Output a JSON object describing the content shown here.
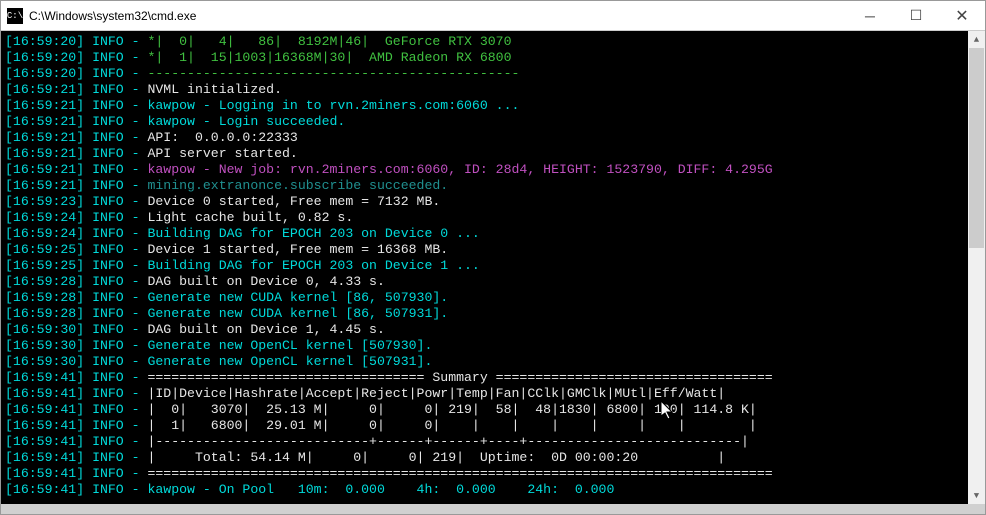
{
  "window": {
    "title": "C:\\Windows\\system32\\cmd.exe",
    "icon_label": "C:\\"
  },
  "lines": [
    {
      "ts": "16:59:20",
      "lvl": "INFO",
      "segs": [
        {
          "c": "green",
          "t": "*|  0|   4|   86|  8192M|46|  GeForce RTX 3070"
        }
      ]
    },
    {
      "ts": "16:59:20",
      "lvl": "INFO",
      "segs": [
        {
          "c": "green",
          "t": "*|  1|  15|1003|16368M|30|  AMD Radeon RX 6800"
        }
      ]
    },
    {
      "ts": "16:59:20",
      "lvl": "INFO",
      "segs": [
        {
          "c": "green",
          "t": "-----------------------------------------------"
        }
      ]
    },
    {
      "ts": "16:59:21",
      "lvl": "INFO",
      "segs": [
        {
          "c": "white",
          "t": "NVML initialized."
        }
      ]
    },
    {
      "ts": "16:59:21",
      "lvl": "INFO",
      "segs": [
        {
          "c": "cyan",
          "t": "kawpow - Logging in to rvn.2miners.com:6060 ..."
        }
      ]
    },
    {
      "ts": "16:59:21",
      "lvl": "INFO",
      "segs": [
        {
          "c": "cyan",
          "t": "kawpow - Login succeeded."
        }
      ]
    },
    {
      "ts": "16:59:21",
      "lvl": "INFO",
      "segs": [
        {
          "c": "white",
          "t": "API:  0.0.0.0:22333"
        }
      ]
    },
    {
      "ts": "16:59:21",
      "lvl": "INFO",
      "segs": [
        {
          "c": "white",
          "t": "API server started."
        }
      ]
    },
    {
      "ts": "16:59:21",
      "lvl": "INFO",
      "segs": [
        {
          "c": "magenta",
          "t": "kawpow - New job: rvn.2miners.com:6060, ID: 28d4, HEIGHT: 1523790, DIFF: 4.295G"
        }
      ]
    },
    {
      "ts": "16:59:21",
      "lvl": "INFO",
      "segs": [
        {
          "c": "teal",
          "t": "mining.extranonce.subscribe succeeded."
        }
      ]
    },
    {
      "ts": "16:59:23",
      "lvl": "INFO",
      "segs": [
        {
          "c": "white",
          "t": "Device 0 started, Free mem = 7132 MB."
        }
      ]
    },
    {
      "ts": "16:59:24",
      "lvl": "INFO",
      "segs": [
        {
          "c": "white",
          "t": "Light cache built, 0.82 s."
        }
      ]
    },
    {
      "ts": "16:59:24",
      "lvl": "INFO",
      "segs": [
        {
          "c": "cyan",
          "t": "Building DAG for EPOCH 203 on Device 0 ..."
        }
      ]
    },
    {
      "ts": "16:59:25",
      "lvl": "INFO",
      "segs": [
        {
          "c": "white",
          "t": "Device 1 started, Free mem = 16368 MB."
        }
      ]
    },
    {
      "ts": "16:59:25",
      "lvl": "INFO",
      "segs": [
        {
          "c": "cyan",
          "t": "Building DAG for EPOCH 203 on Device 1 ..."
        }
      ]
    },
    {
      "ts": "16:59:28",
      "lvl": "INFO",
      "segs": [
        {
          "c": "white",
          "t": "DAG built on Device 0, 4.33 s."
        }
      ]
    },
    {
      "ts": "16:59:28",
      "lvl": "INFO",
      "segs": [
        {
          "c": "cyan",
          "t": "Generate new CUDA kernel [86, 507930]."
        }
      ]
    },
    {
      "ts": "16:59:28",
      "lvl": "INFO",
      "segs": [
        {
          "c": "cyan",
          "t": "Generate new CUDA kernel [86, 507931]."
        }
      ]
    },
    {
      "ts": "16:59:30",
      "lvl": "INFO",
      "segs": [
        {
          "c": "white",
          "t": "DAG built on Device 1, 4.45 s."
        }
      ]
    },
    {
      "ts": "16:59:30",
      "lvl": "INFO",
      "segs": [
        {
          "c": "cyan",
          "t": "Generate new OpenCL kernel [507930]."
        }
      ]
    },
    {
      "ts": "16:59:30",
      "lvl": "INFO",
      "segs": [
        {
          "c": "cyan",
          "t": "Generate new OpenCL kernel [507931]."
        }
      ]
    },
    {
      "ts": "16:59:41",
      "lvl": "INFO",
      "segs": [
        {
          "c": "white",
          "t": "=================================== Summary ==================================="
        }
      ]
    },
    {
      "ts": "16:59:41",
      "lvl": "INFO",
      "segs": [
        {
          "c": "white",
          "t": "|ID|Device|Hashrate|Accept|Reject|Powr|Temp|Fan|CClk|GMClk|MUtl|Eff/Watt|"
        }
      ]
    },
    {
      "ts": "16:59:41",
      "lvl": "INFO",
      "segs": [
        {
          "c": "white",
          "t": "|  0|   3070|  25.13 M|     0|     0| 219|  58|  48|1830| 6800| 100| 114.8 K|"
        }
      ]
    },
    {
      "ts": "16:59:41",
      "lvl": "INFO",
      "segs": [
        {
          "c": "white",
          "t": "|  1|   6800|  29.01 M|     0|     0|    |    |    |    |     |    |        |"
        }
      ]
    },
    {
      "ts": "16:59:41",
      "lvl": "INFO",
      "segs": [
        {
          "c": "white",
          "t": "|---------------------------+------+------+----+---------------------------|"
        }
      ]
    },
    {
      "ts": "16:59:41",
      "lvl": "INFO",
      "segs": [
        {
          "c": "white",
          "t": "|     Total: 54.14 M|     0|     0| 219|  Uptime:  0D 00:00:20          |"
        }
      ]
    },
    {
      "ts": "16:59:41",
      "lvl": "INFO",
      "segs": [
        {
          "c": "white",
          "t": "==============================================================================="
        }
      ]
    },
    {
      "ts": "16:59:41",
      "lvl": "INFO",
      "segs": [
        {
          "c": "cyan",
          "t": "kawpow - On Pool   10m:  0.000    4h:  0.000    24h:  0.000"
        }
      ]
    }
  ],
  "summary_table": {
    "headers": [
      "ID",
      "Device",
      "Hashrate",
      "Accept",
      "Reject",
      "Powr",
      "Temp",
      "Fan",
      "CClk",
      "GMClk",
      "MUtl",
      "Eff/Watt"
    ],
    "rows": [
      {
        "ID": 0,
        "Device": "3070",
        "Hashrate": "25.13 M",
        "Accept": 0,
        "Reject": 0,
        "Powr": 219,
        "Temp": 58,
        "Fan": 48,
        "CClk": 1830,
        "GMClk": 6800,
        "MUtl": 100,
        "Eff/Watt": "114.8 K"
      },
      {
        "ID": 1,
        "Device": "6800",
        "Hashrate": "29.01 M",
        "Accept": 0,
        "Reject": 0,
        "Powr": "",
        "Temp": "",
        "Fan": "",
        "CClk": "",
        "GMClk": "",
        "MUtl": "",
        "Eff/Watt": ""
      }
    ],
    "total": {
      "Hashrate": "54.14 M",
      "Accept": 0,
      "Reject": 0,
      "Powr": 219,
      "Uptime": "0D 00:00:20"
    }
  }
}
